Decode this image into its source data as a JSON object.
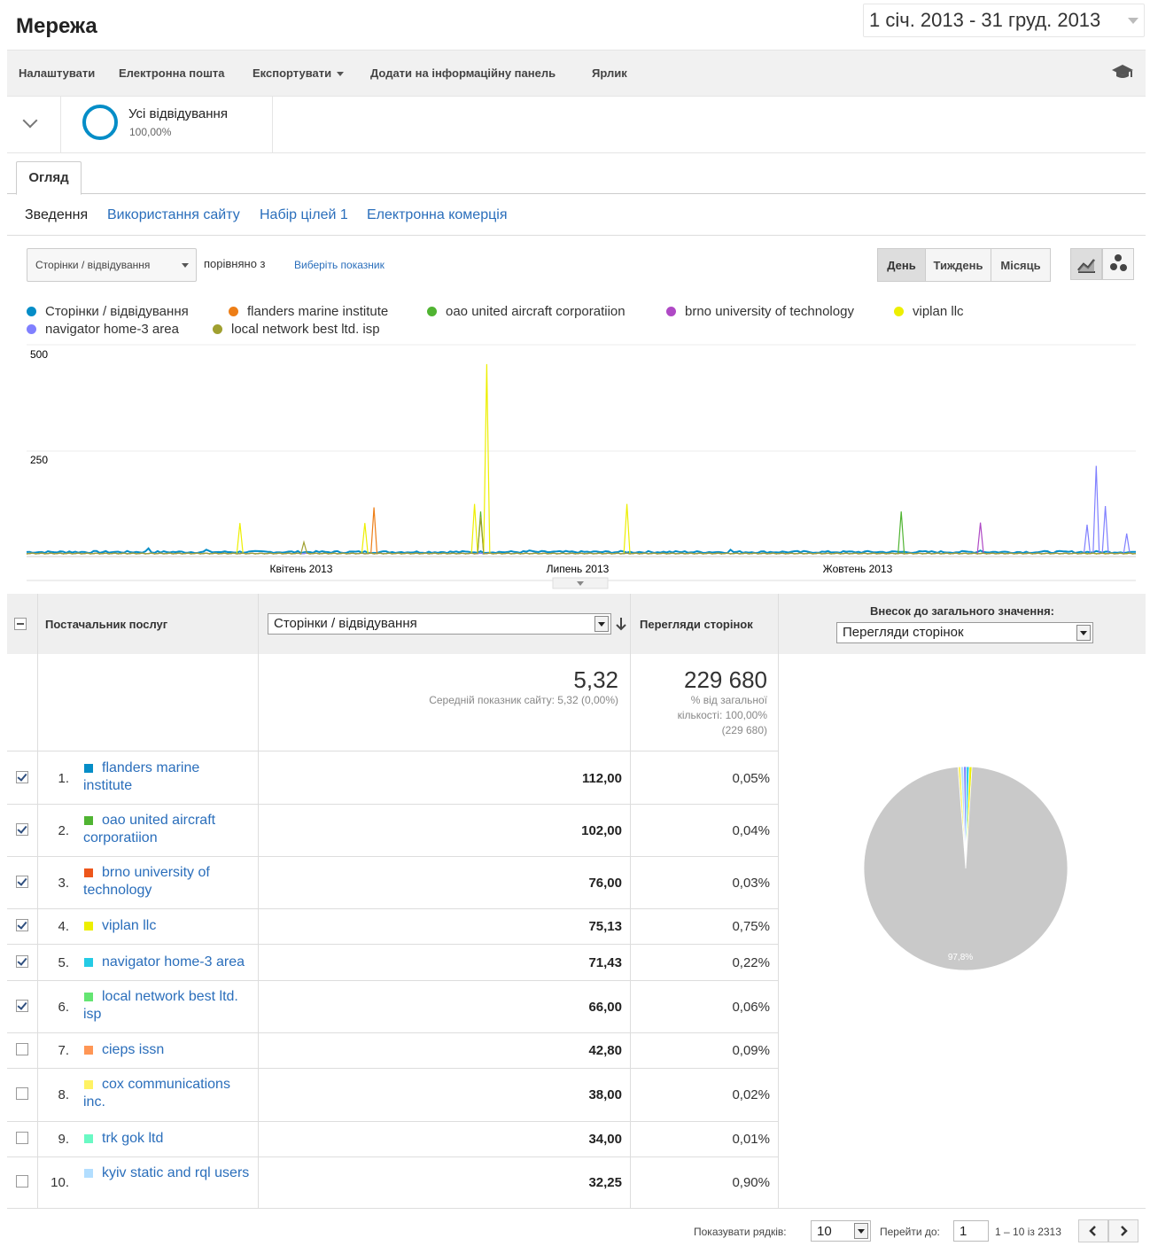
{
  "header": {
    "title": "Мережа",
    "date_range": "1 січ. 2013 - 31 груд. 2013"
  },
  "toolbar": {
    "customize": "Налаштувати",
    "email": "Електронна пошта",
    "export": "Експортувати",
    "add_dashboard": "Додати на інформаційну панель",
    "shortcut": "Ярлик"
  },
  "segment": {
    "name": "Усі відвідування",
    "percent": "100,00%"
  },
  "tabs": {
    "overview": "Огляд"
  },
  "subnav": {
    "summary": "Зведення",
    "site_usage": "Використання сайту",
    "goal_set": "Набір цілей 1",
    "ecommerce": "Електронна комерція"
  },
  "chart_controls": {
    "metric": "Сторінки / відвідування",
    "compare_to": "порівняно з",
    "select_metric": "Виберіть показник",
    "day": "День",
    "week": "Тиждень",
    "month": "Місяць"
  },
  "colors": {
    "primary": "#058dc7",
    "flanders": "#ed7e17",
    "oao": "#50b432",
    "brno": "#af49c5",
    "viplan": "#edef00",
    "navigator": "#8080ff",
    "local": "#a0a030",
    "link": "#2a6ebb",
    "pie": "#c9c9c9"
  },
  "chart_data": {
    "type": "line",
    "x_labels": [
      "Квітень 2013",
      "Липень 2013",
      "Жовтень 2013"
    ],
    "y_ticks": [
      "500",
      "250"
    ],
    "ylim": [
      0,
      500
    ],
    "series": [
      {
        "name": "Сторінки / відвідування",
        "color": "#058dc7",
        "peaks": [
          {
            "x": "2013-01-15",
            "y": 8
          },
          {
            "x": "2013-02-10",
            "y": 15
          },
          {
            "x": "2013-03-01",
            "y": 12
          },
          {
            "x": "2013-06-15",
            "y": 10
          },
          {
            "x": "2013-08-20",
            "y": 12
          },
          {
            "x": "2013-11-10",
            "y": 10
          }
        ]
      },
      {
        "name": "flanders marine institute",
        "color": "#ed7e17",
        "peaks": [
          {
            "x": "2013-04-25",
            "y": 112
          }
        ]
      },
      {
        "name": "oao united aircraft corporatiion",
        "color": "#50b432",
        "peaks": [
          {
            "x": "2013-05-30",
            "y": 102
          },
          {
            "x": "2013-10-15",
            "y": 102
          }
        ]
      },
      {
        "name": "brno university of technology",
        "color": "#af49c5",
        "peaks": [
          {
            "x": "2013-11-10",
            "y": 76
          }
        ]
      },
      {
        "name": "viplan llc",
        "color": "#edef00",
        "peaks": [
          {
            "x": "2013-03-12",
            "y": 75
          },
          {
            "x": "2013-04-22",
            "y": 75
          },
          {
            "x": "2013-05-28",
            "y": 120
          },
          {
            "x": "2013-06-01",
            "y": 450
          },
          {
            "x": "2013-07-17",
            "y": 120
          }
        ]
      },
      {
        "name": "navigator home-3 area",
        "color": "#8080ff",
        "peaks": [
          {
            "x": "2013-12-15",
            "y": 71
          },
          {
            "x": "2013-12-18",
            "y": 210
          },
          {
            "x": "2013-12-21",
            "y": 115
          },
          {
            "x": "2013-12-28",
            "y": 50
          }
        ]
      },
      {
        "name": "local network best ltd. isp",
        "color": "#a0a030",
        "peaks": [
          {
            "x": "2013-04-02",
            "y": 30
          },
          {
            "x": "2013-05-30",
            "y": 90
          }
        ]
      }
    ]
  },
  "table": {
    "col_provider": "Постачальник послуг",
    "col_metric": "Сторінки / відвідування",
    "col_pageviews": "Перегляди сторінок",
    "col_contribution": "Внесок до загального значення:",
    "contribution_select": "Перегляди сторінок",
    "summary": {
      "metric_value": "5,32",
      "metric_note": "Середній показник сайту: 5,32 (0,00%)",
      "pageviews_value": "229 680",
      "pageviews_note1": "% від загальної",
      "pageviews_note2": "кількості: 100,00%",
      "pageviews_note3": "(229 680)"
    },
    "rows": [
      {
        "n": "1.",
        "name": "flanders marine institute",
        "val": "112,00",
        "pct": "0,05%",
        "checked": true,
        "color": "#058dc7"
      },
      {
        "n": "2.",
        "name": "oao united aircraft corporatiion",
        "val": "102,00",
        "pct": "0,04%",
        "checked": true,
        "color": "#50b432"
      },
      {
        "n": "3.",
        "name": "brno university of technology",
        "val": "76,00",
        "pct": "0,03%",
        "checked": true,
        "color": "#ed561b"
      },
      {
        "n": "4.",
        "name": "viplan llc",
        "val": "75,13",
        "pct": "0,75%",
        "checked": true,
        "color": "#edef00"
      },
      {
        "n": "5.",
        "name": "navigator home-3 area",
        "val": "71,43",
        "pct": "0,22%",
        "checked": true,
        "color": "#24cbe5"
      },
      {
        "n": "6.",
        "name": "local network best ltd. isp",
        "val": "66,00",
        "pct": "0,06%",
        "checked": true,
        "color": "#64e572"
      },
      {
        "n": "7.",
        "name": "cieps issn",
        "val": "42,80",
        "pct": "0,09%",
        "checked": false,
        "color": "#ff9655"
      },
      {
        "n": "8.",
        "name": "cox communications inc.",
        "val": "38,00",
        "pct": "0,02%",
        "checked": false,
        "color": "#fff263"
      },
      {
        "n": "9.",
        "name": "trk gok ltd",
        "val": "34,00",
        "pct": "0,01%",
        "checked": false,
        "color": "#6af9c4"
      },
      {
        "n": "10.",
        "name": "kyiv static and rql users",
        "val": "32,25",
        "pct": "0,90%",
        "checked": false,
        "color": "#b2deff"
      }
    ],
    "pie_label": "97,8%",
    "pie_value": 97.8
  },
  "pager": {
    "show_rows": "Показувати рядків:",
    "rows_value": "10",
    "goto": "Перейти до:",
    "goto_value": "1",
    "range": "1 – 10 із 2313"
  }
}
